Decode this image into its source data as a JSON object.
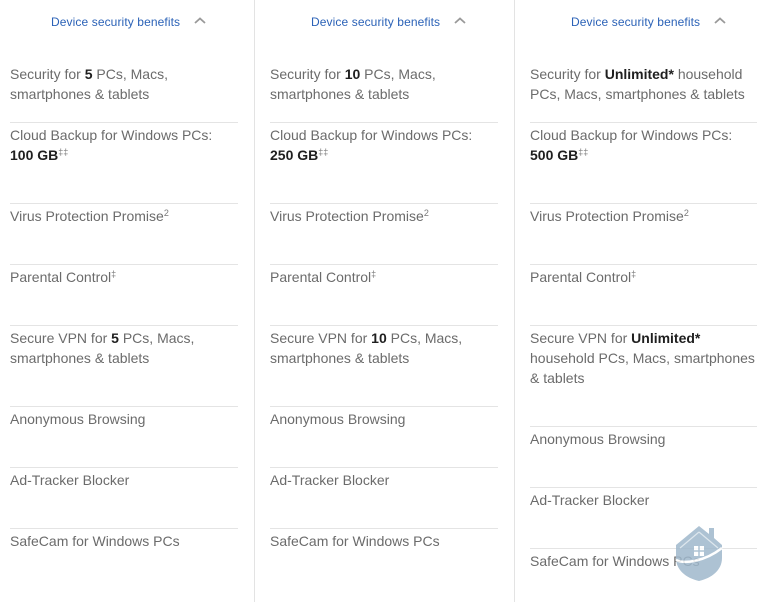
{
  "plans": [
    {
      "header": {
        "label": "Device security benefits",
        "chevron": "chevron-up-icon"
      },
      "features": [
        {
          "pre": "Security for ",
          "bold": "5",
          "post": " PCs, Macs, smartphones & tablets",
          "sup": ""
        },
        {
          "pre": "Cloud Backup for Windows PCs: ",
          "bold": "100 GB",
          "post": "",
          "sup": "‡‡"
        },
        {
          "pre": "Virus Protection Promise",
          "bold": "",
          "post": "",
          "sup": "2"
        },
        {
          "pre": "Parental Control",
          "bold": "",
          "post": "",
          "sup": "‡"
        },
        {
          "pre": "Secure VPN for ",
          "bold": "5",
          "post": " PCs, Macs, smartphones & tablets",
          "sup": ""
        },
        {
          "pre": "Anonymous Browsing",
          "bold": "",
          "post": "",
          "sup": ""
        },
        {
          "pre": "Ad-Tracker Blocker",
          "bold": "",
          "post": "",
          "sup": ""
        },
        {
          "pre": "SafeCam for Windows PCs",
          "bold": "",
          "post": "",
          "sup": ""
        }
      ]
    },
    {
      "header": {
        "label": "Device security benefits",
        "chevron": "chevron-up-icon"
      },
      "features": [
        {
          "pre": "Security for ",
          "bold": "10",
          "post": " PCs, Macs, smartphones & tablets",
          "sup": ""
        },
        {
          "pre": "Cloud Backup for Windows PCs: ",
          "bold": "250 GB",
          "post": "",
          "sup": "‡‡"
        },
        {
          "pre": "Virus Protection Promise",
          "bold": "",
          "post": "",
          "sup": "2"
        },
        {
          "pre": "Parental Control",
          "bold": "",
          "post": "",
          "sup": "‡"
        },
        {
          "pre": "Secure VPN for ",
          "bold": "10",
          "post": " PCs, Macs, smartphones & tablets",
          "sup": ""
        },
        {
          "pre": "Anonymous Browsing",
          "bold": "",
          "post": "",
          "sup": ""
        },
        {
          "pre": "Ad-Tracker Blocker",
          "bold": "",
          "post": "",
          "sup": ""
        },
        {
          "pre": "SafeCam for Windows PCs",
          "bold": "",
          "post": "",
          "sup": ""
        }
      ]
    },
    {
      "header": {
        "label": "Device security benefits",
        "chevron": "chevron-up-icon"
      },
      "features": [
        {
          "pre": "Security for ",
          "bold": "Unlimited*",
          "post": " household PCs, Macs, smartphones & tablets",
          "sup": ""
        },
        {
          "pre": "Cloud Backup for Windows PCs: ",
          "bold": "500 GB",
          "post": "",
          "sup": "‡‡"
        },
        {
          "pre": "Virus Protection Promise",
          "bold": "",
          "post": "",
          "sup": "2"
        },
        {
          "pre": "Parental Control",
          "bold": "",
          "post": "",
          "sup": "‡"
        },
        {
          "pre": "Secure VPN for ",
          "bold": "Unlimited*",
          "post": " household PCs, Macs, smartphones & tablets",
          "sup": ""
        },
        {
          "pre": "Anonymous Browsing",
          "bold": "",
          "post": "",
          "sup": ""
        },
        {
          "pre": "Ad-Tracker Blocker",
          "bold": "",
          "post": "",
          "sup": ""
        },
        {
          "pre": "SafeCam for Windows PCs",
          "bold": "",
          "post": "",
          "sup": ""
        }
      ]
    }
  ],
  "colors": {
    "header_link": "#2b62b7",
    "body_text": "#6b6b6b",
    "bold_text": "#1f1f1f",
    "divider": "#e4e4e4",
    "watermark": "#9fb8cc"
  },
  "watermark": {
    "icon": "house-shield-logo-icon"
  }
}
